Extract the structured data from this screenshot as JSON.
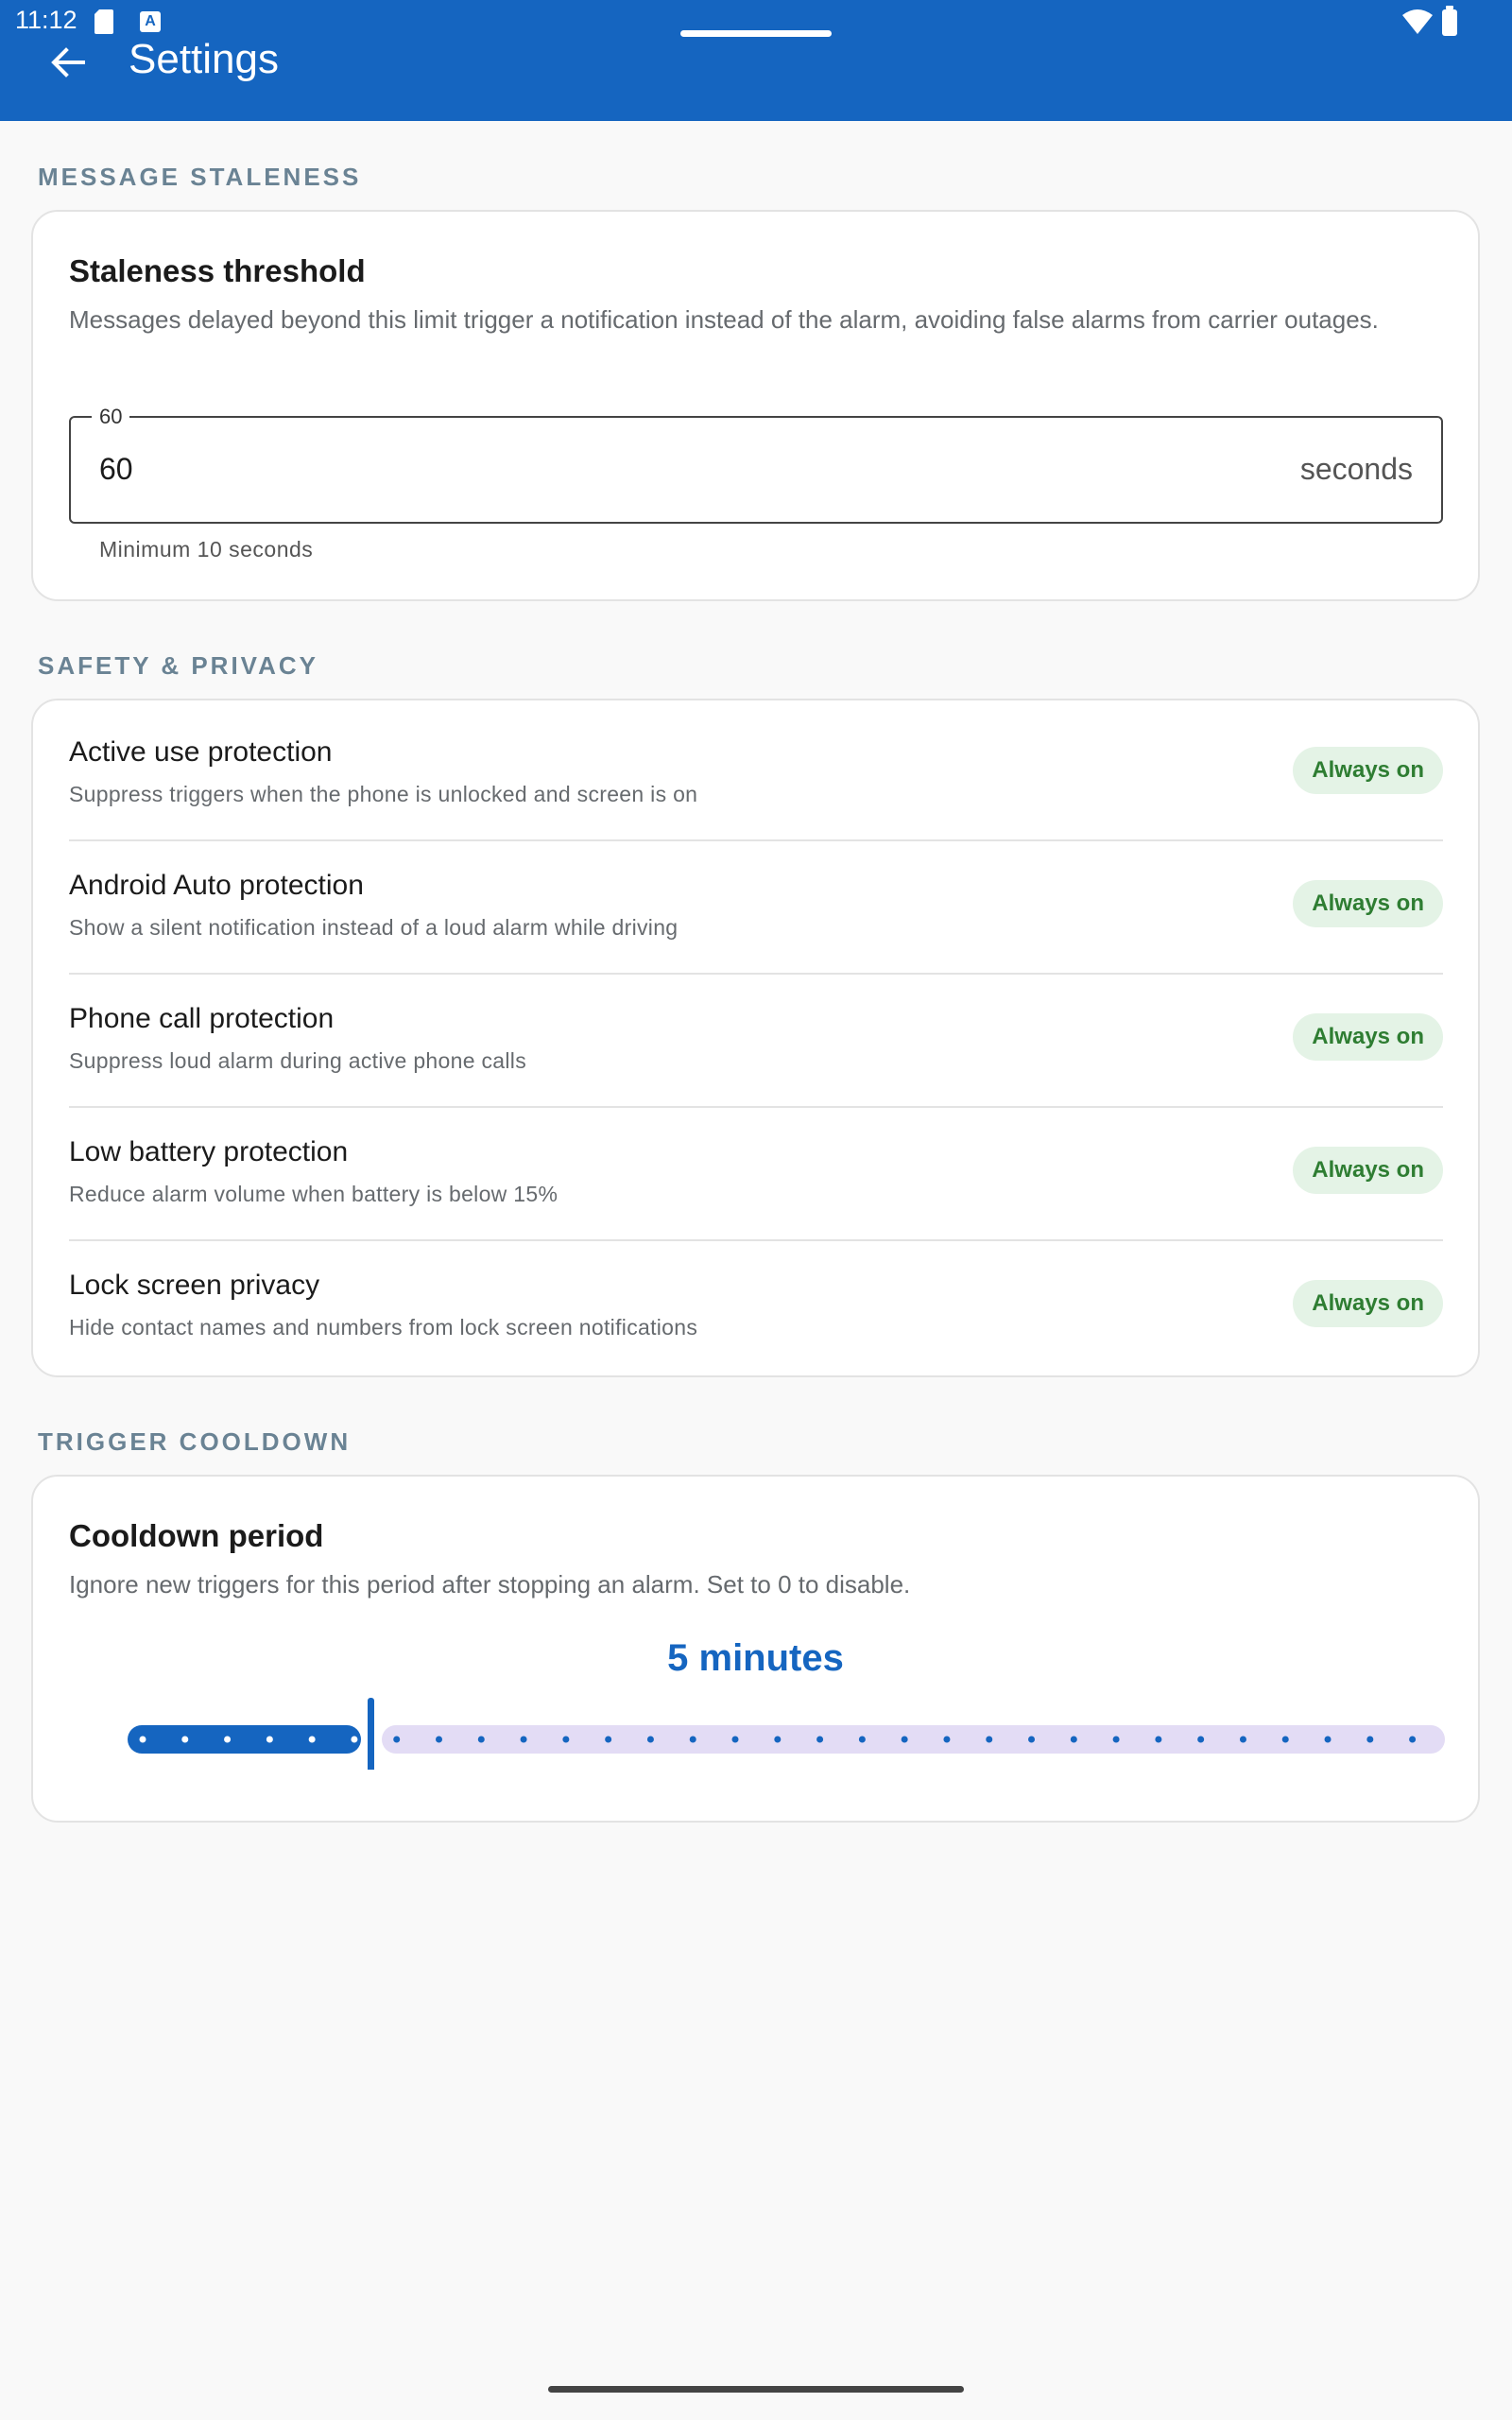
{
  "status_bar": {
    "time": "11:12"
  },
  "app_bar": {
    "title": "Settings",
    "back_icon": "arrow-back-icon"
  },
  "sections": {
    "staleness": {
      "header": "MESSAGE STALENESS",
      "title": "Staleness threshold",
      "description": "Messages delayed beyond this limit trigger a notification instead of the alarm, avoiding false alarms from carrier outages.",
      "field": {
        "label": "60",
        "value": "60",
        "suffix": "seconds",
        "helper": "Minimum 10 seconds"
      }
    },
    "safety": {
      "header": "SAFETY & PRIVACY",
      "items": [
        {
          "title": "Active use protection",
          "subtitle": "Suppress triggers when the phone is unlocked and screen is on",
          "badge": "Always on"
        },
        {
          "title": "Android Auto protection",
          "subtitle": "Show a silent notification instead of a loud alarm while driving",
          "badge": "Always on"
        },
        {
          "title": "Phone call protection",
          "subtitle": "Suppress loud alarm during active phone calls",
          "badge": "Always on"
        },
        {
          "title": "Low battery protection",
          "subtitle": "Reduce alarm volume when battery is below 15%",
          "badge": "Always on"
        },
        {
          "title": "Lock screen privacy",
          "subtitle": "Hide contact names and numbers from lock screen notifications",
          "badge": "Always on"
        }
      ]
    },
    "cooldown": {
      "header": "TRIGGER COOLDOWN",
      "title": "Cooldown period",
      "description": "Ignore new triggers for this period after stopping an alarm. Set to 0 to disable.",
      "value_label": "5 minutes",
      "slider": {
        "value": 5,
        "min": 0,
        "max": 30,
        "steps": 30
      }
    }
  },
  "colors": {
    "primary": "#1565c0",
    "badge_bg": "#e4f3e6",
    "badge_text": "#2e7d32",
    "section_header": "#6a8394",
    "slider_inactive": "#e3dcf5"
  }
}
